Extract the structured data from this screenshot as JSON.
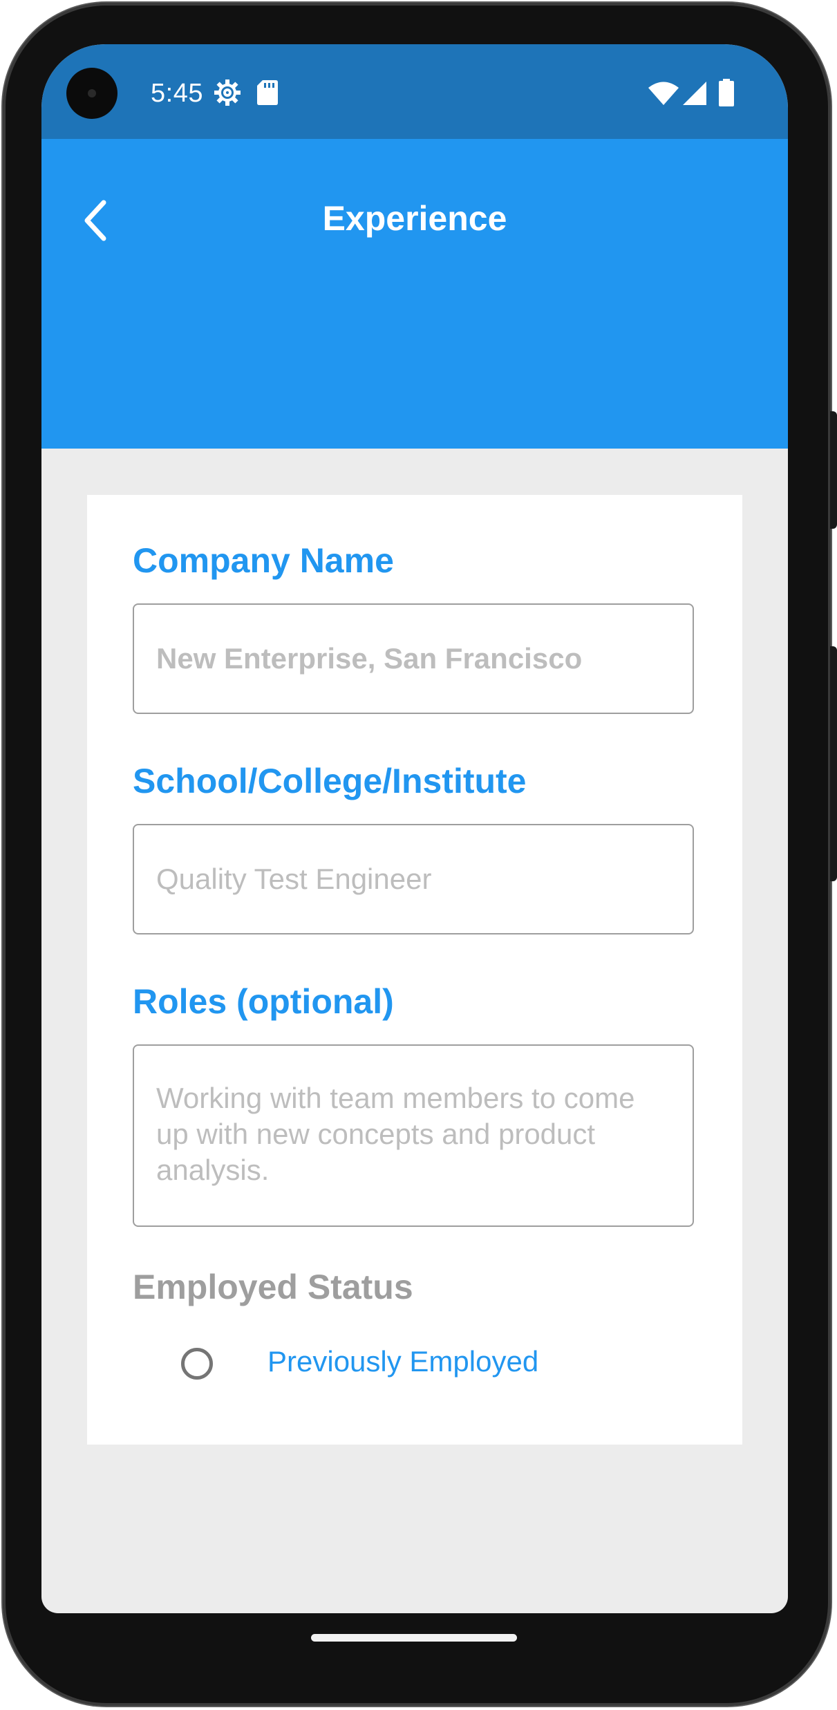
{
  "status_bar": {
    "time": "5:45",
    "left_icons": [
      "settings-gear-icon",
      "sd-card-icon"
    ],
    "right_icons": [
      "wifi-icon",
      "cell-signal-icon",
      "battery-icon"
    ]
  },
  "app_bar": {
    "title": "Experience",
    "back_icon": "chevron-left-icon"
  },
  "form": {
    "company_name": {
      "label": "Company Name",
      "placeholder": "New Enterprise, San Francisco"
    },
    "school": {
      "label": "School/College/Institute",
      "placeholder": "Quality Test Engineer"
    },
    "roles": {
      "label": "Roles (optional)",
      "placeholder": "Working with team members to come up with new concepts and product analysis."
    },
    "employed_status": {
      "label": "Employed Status",
      "option_label": "Previously Employed",
      "selected": false
    }
  },
  "colors": {
    "status_bar": "#1e74b8",
    "app_bar": "#2196f0",
    "accent": "#2196f0",
    "background": "#ececec",
    "placeholder": "#bdbdbd",
    "muted_label": "#9e9e9e"
  }
}
